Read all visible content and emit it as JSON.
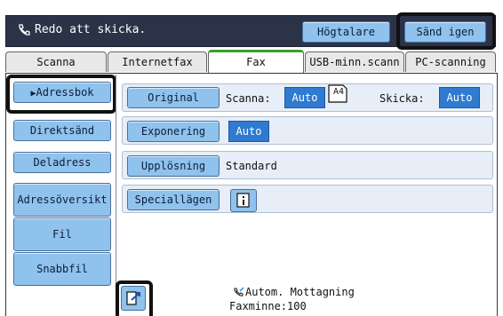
{
  "status": {
    "text": "Redo att skicka.",
    "speaker_label": "Högtalare",
    "resend_label": "Sänd igen"
  },
  "tabs": [
    {
      "label": "Scanna"
    },
    {
      "label": "Internetfax"
    },
    {
      "label": "Fax"
    },
    {
      "label": "USB-minn.scann"
    },
    {
      "label": "PC-scanning"
    }
  ],
  "left_menu": [
    {
      "label": "Adressbok"
    },
    {
      "label": "Direktsänd"
    },
    {
      "label": "Deladress"
    },
    {
      "label": "Adressöversikt"
    },
    {
      "label": "Fil"
    },
    {
      "label": "Snabbfil"
    }
  ],
  "settings": {
    "original": {
      "label": "Original",
      "scan_label": "Scanna:",
      "scan_value": "Auto",
      "size_label": "A4",
      "send_label": "Skicka:",
      "send_value": "Auto"
    },
    "exposure": {
      "label": "Exponering",
      "value": "Auto"
    },
    "resolution": {
      "label": "Upplösning",
      "value": "Standard"
    },
    "special": {
      "label": "Speciallägen"
    }
  },
  "footer": {
    "auto_receive": "Autom. Mottagning",
    "fax_memory": "Faxminne:100"
  },
  "icons": {
    "phone": "phone-icon",
    "info": "info-icon",
    "preview": "preview-icon",
    "receive": "auto-receive-icon"
  },
  "colors": {
    "accent_blue": "#8fc2ec",
    "value_blue": "#2e7bd0",
    "dark_status": "#2a3348",
    "active_tab_green": "#38a12d"
  }
}
